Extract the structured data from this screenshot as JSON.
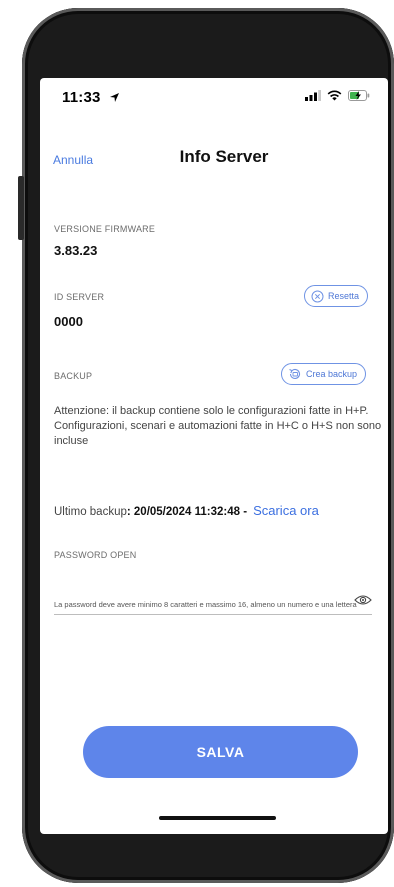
{
  "status": {
    "time": "11:33"
  },
  "nav": {
    "cancel_label": "Annulla",
    "title": "Info Server"
  },
  "firmware": {
    "label": "VERSIONE FIRMWARE",
    "value": "3.83.23"
  },
  "server_id": {
    "label": "ID SERVER",
    "value": "0000",
    "reset_label": "Resetta"
  },
  "backup": {
    "label": "BACKUP",
    "create_label": "Crea backup",
    "warning": "Attenzione: il backup contiene solo le configurazioni fatte in H+P. Configurazioni, scenari e automazioni fatte in H+C o H+S non sono incluse",
    "last_label": "Ultimo backup",
    "last_date": ": 20/05/2024 11:32:48 -",
    "download_label": "Scarica ora"
  },
  "password": {
    "label": "PASSWORD OPEN",
    "value": "",
    "hint": "La password deve avere minimo 8 caratteri e massimo 16, almeno un numero e una lettera"
  },
  "save_label": "SALVA",
  "colors": {
    "accent": "#5e85ea",
    "link": "#3b6fe0",
    "battery": "#3fb34f"
  }
}
